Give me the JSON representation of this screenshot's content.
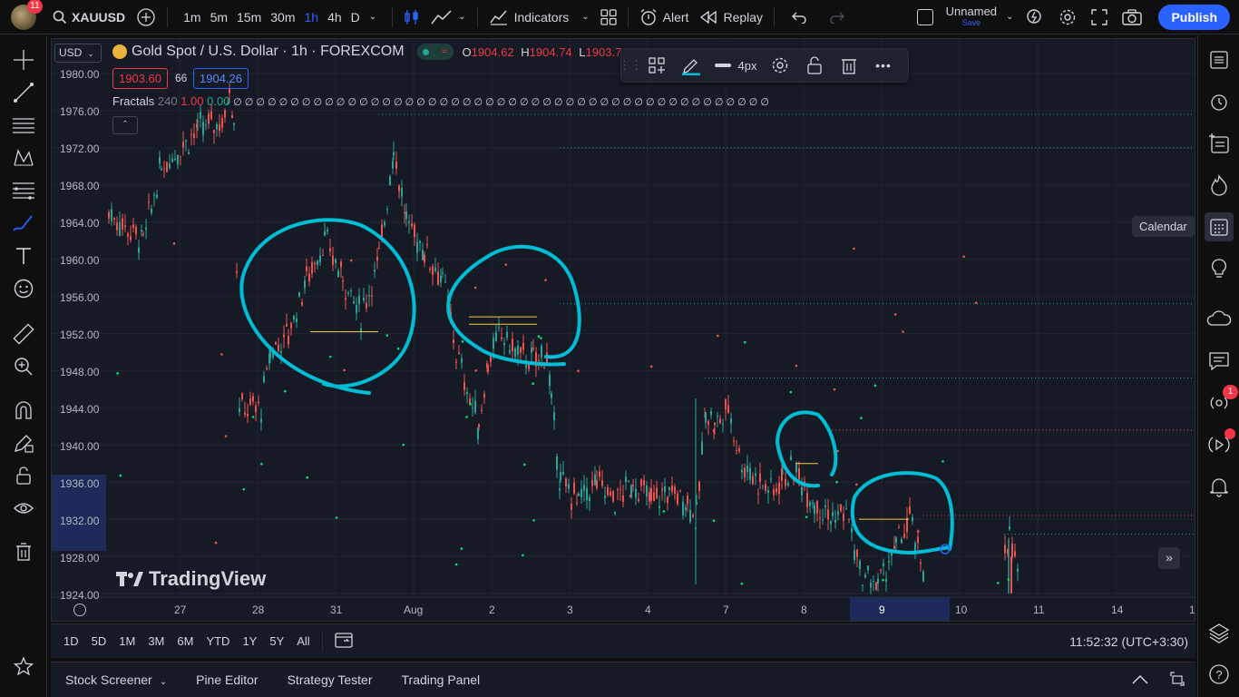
{
  "topbar": {
    "notifications_count": "11",
    "symbol": "XAUUSD",
    "intervals": [
      "1m",
      "5m",
      "15m",
      "30m",
      "1h",
      "4h",
      "D"
    ],
    "active_interval": "1h",
    "indicators_label": "Indicators",
    "alert_label": "Alert",
    "replay_label": "Replay",
    "layout_name": "Unnamed",
    "layout_save": "Save",
    "publish_label": "Publish"
  },
  "legend": {
    "title": "Gold Spot / U.S. Dollar · 1h · FOREXCOM",
    "open_label": "O",
    "open": "1904.62",
    "high_label": "H",
    "high": "1904.74",
    "low_label": "L",
    "low": "1903.71",
    "bid": "1903.60",
    "spread": "66",
    "ask": "1904.26",
    "indicator_name": "Fractals",
    "indicator_param": "240",
    "indicator_val1": "1.00",
    "indicator_val2": "0.00",
    "indicator_nulls": "∅ ∅ ∅ ∅ ∅ ∅ ∅ ∅ ∅ ∅ ∅ ∅ ∅ ∅ ∅ ∅ ∅ ∅ ∅ ∅ ∅ ∅ ∅ ∅ ∅ ∅ ∅ ∅ ∅ ∅ ∅ ∅ ∅ ∅ ∅ ∅ ∅ ∅ ∅ ∅ ∅ ∅ ∅ ∅ ∅ ∅ ∅"
  },
  "currency": "USD",
  "price_axis": [
    "1980.00",
    "1976.00",
    "1972.00",
    "1968.00",
    "1964.00",
    "1960.00",
    "1956.00",
    "1952.00",
    "1948.00",
    "1944.00",
    "1940.00",
    "1936.00",
    "1932.00",
    "1928.00",
    "1924.00"
  ],
  "time_axis": [
    "27",
    "28",
    "31",
    "Aug",
    "2",
    "3",
    "4",
    "7",
    "8",
    "9",
    "10",
    "11",
    "14",
    "1"
  ],
  "watermark": "TradingView",
  "floating_toolbar": {
    "width_label": "4px"
  },
  "tooltip": "Calendar",
  "right_badge": "1",
  "bottom": {
    "ranges": [
      "1D",
      "5D",
      "1M",
      "3M",
      "6M",
      "YTD",
      "1Y",
      "5Y",
      "All"
    ],
    "clock": "11:52:32 (UTC+3:30)"
  },
  "panels": [
    "Stock Screener",
    "Pine Editor",
    "Strategy Tester",
    "Trading Panel"
  ],
  "colors": {
    "accent": "#2962ff",
    "up": "#26a69a",
    "down": "#ef5350",
    "drawing": "#00bcd4",
    "bg": "#161a25"
  }
}
